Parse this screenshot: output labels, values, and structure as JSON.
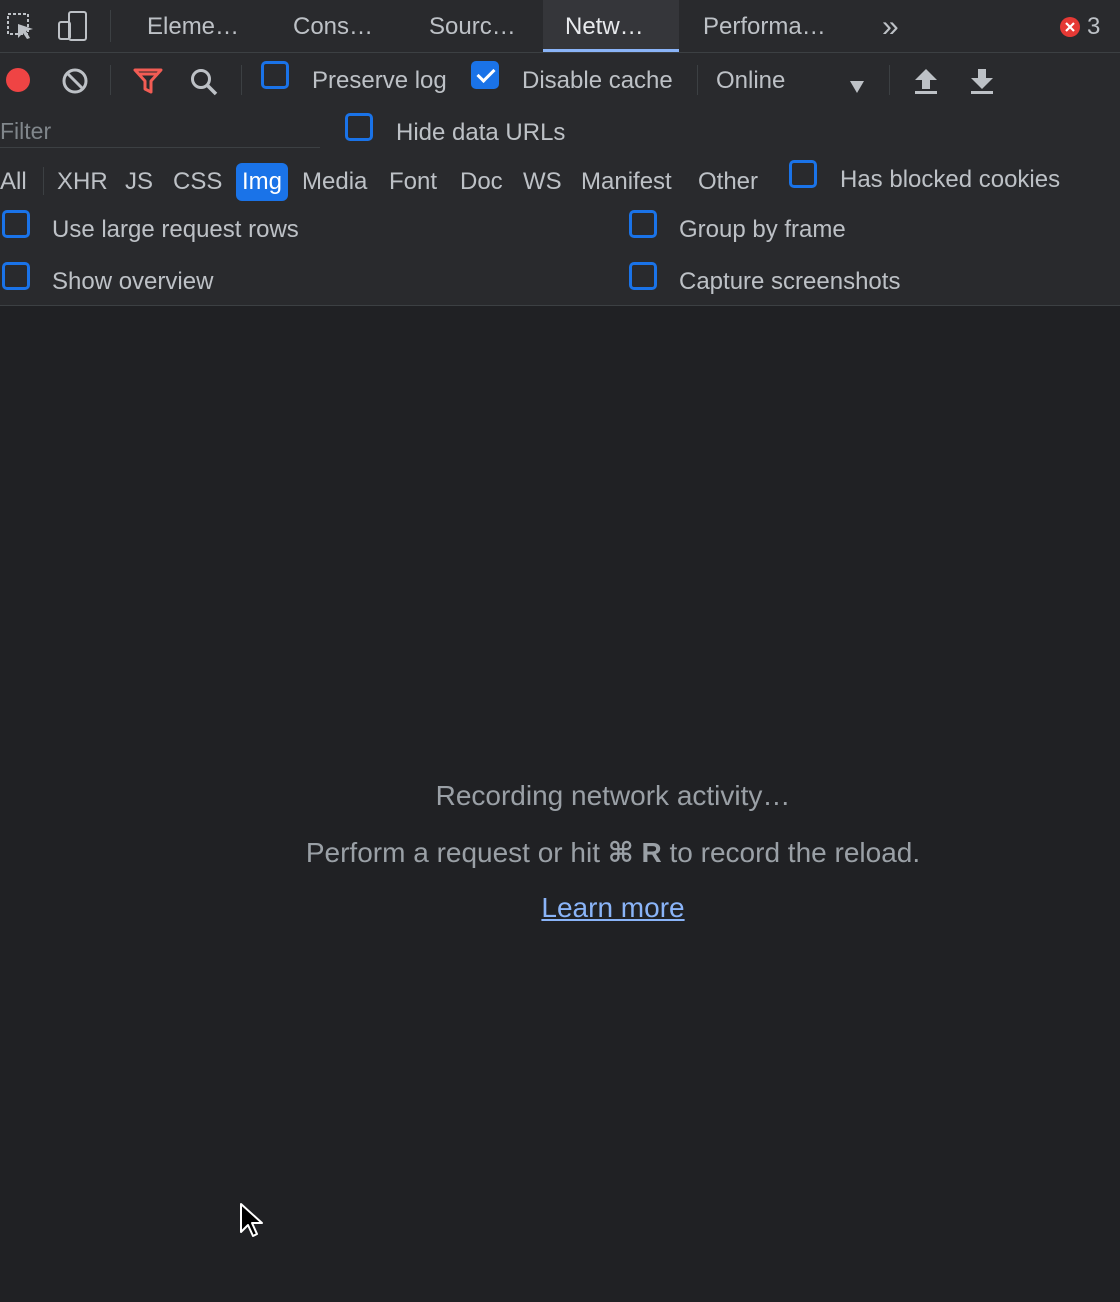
{
  "tabs": [
    {
      "label": "Eleme…"
    },
    {
      "label": "Cons…"
    },
    {
      "label": "Sourc…"
    },
    {
      "label": "Netw…"
    },
    {
      "label": "Performa…"
    }
  ],
  "overflow_label": "»",
  "error_count": "3",
  "toolbar": {
    "preserve_log": "Preserve log",
    "disable_cache": "Disable cache",
    "throttle": "Online"
  },
  "filter": {
    "placeholder": "Filter",
    "hide_data_urls": "Hide data URLs"
  },
  "types": [
    "All",
    "XHR",
    "JS",
    "CSS",
    "Img",
    "Media",
    "Font",
    "Doc",
    "WS",
    "Manifest",
    "Other"
  ],
  "active_type": "Img",
  "has_blocked_cookies": "Has blocked cookies",
  "options": {
    "large_rows": "Use large request rows",
    "group_by_frame": "Group by frame",
    "show_overview": "Show overview",
    "capture_screenshots": "Capture screenshots"
  },
  "empty": {
    "recording": "Recording network activity…",
    "hint_prefix": "Perform a request or hit",
    "shortcut": "⌘ R",
    "hint_suffix": "to record the reload.",
    "learn_more": "Learn more"
  },
  "colors": {
    "accent": "#1a73e8",
    "record": "#ef4444",
    "filter_icon": "#f25c54",
    "link": "#8ab4f8"
  }
}
